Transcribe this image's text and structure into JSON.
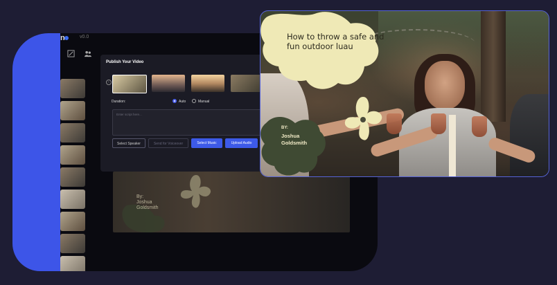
{
  "app": {
    "logo": "n",
    "version": "v0.0"
  },
  "modal": {
    "title": "Publish Your Video",
    "duration_label": "Duration:",
    "duration_options": [
      {
        "label": "Auto",
        "selected": true
      },
      {
        "label": "Manual",
        "selected": false
      }
    ],
    "script_placeholder": "Enter script here...",
    "buttons": {
      "select_speaker": "Select Speaker",
      "send_voiceover": "Send for Voiceover",
      "select_music": "Select Music",
      "upload_audio": "Upload Audio"
    }
  },
  "preview": {
    "byline": "By:\nJoshua\nGoldsmith"
  },
  "card": {
    "headline": "How to throw a safe and fun outdoor luau",
    "by": "BY:",
    "author_first": "Joshua",
    "author_last": "Goldsmith"
  },
  "colors": {
    "background": "#1e1d34",
    "accent_blue": "#3d55e8",
    "blob_cream": "#efe9b6",
    "blob_green": "#3f4a33"
  }
}
